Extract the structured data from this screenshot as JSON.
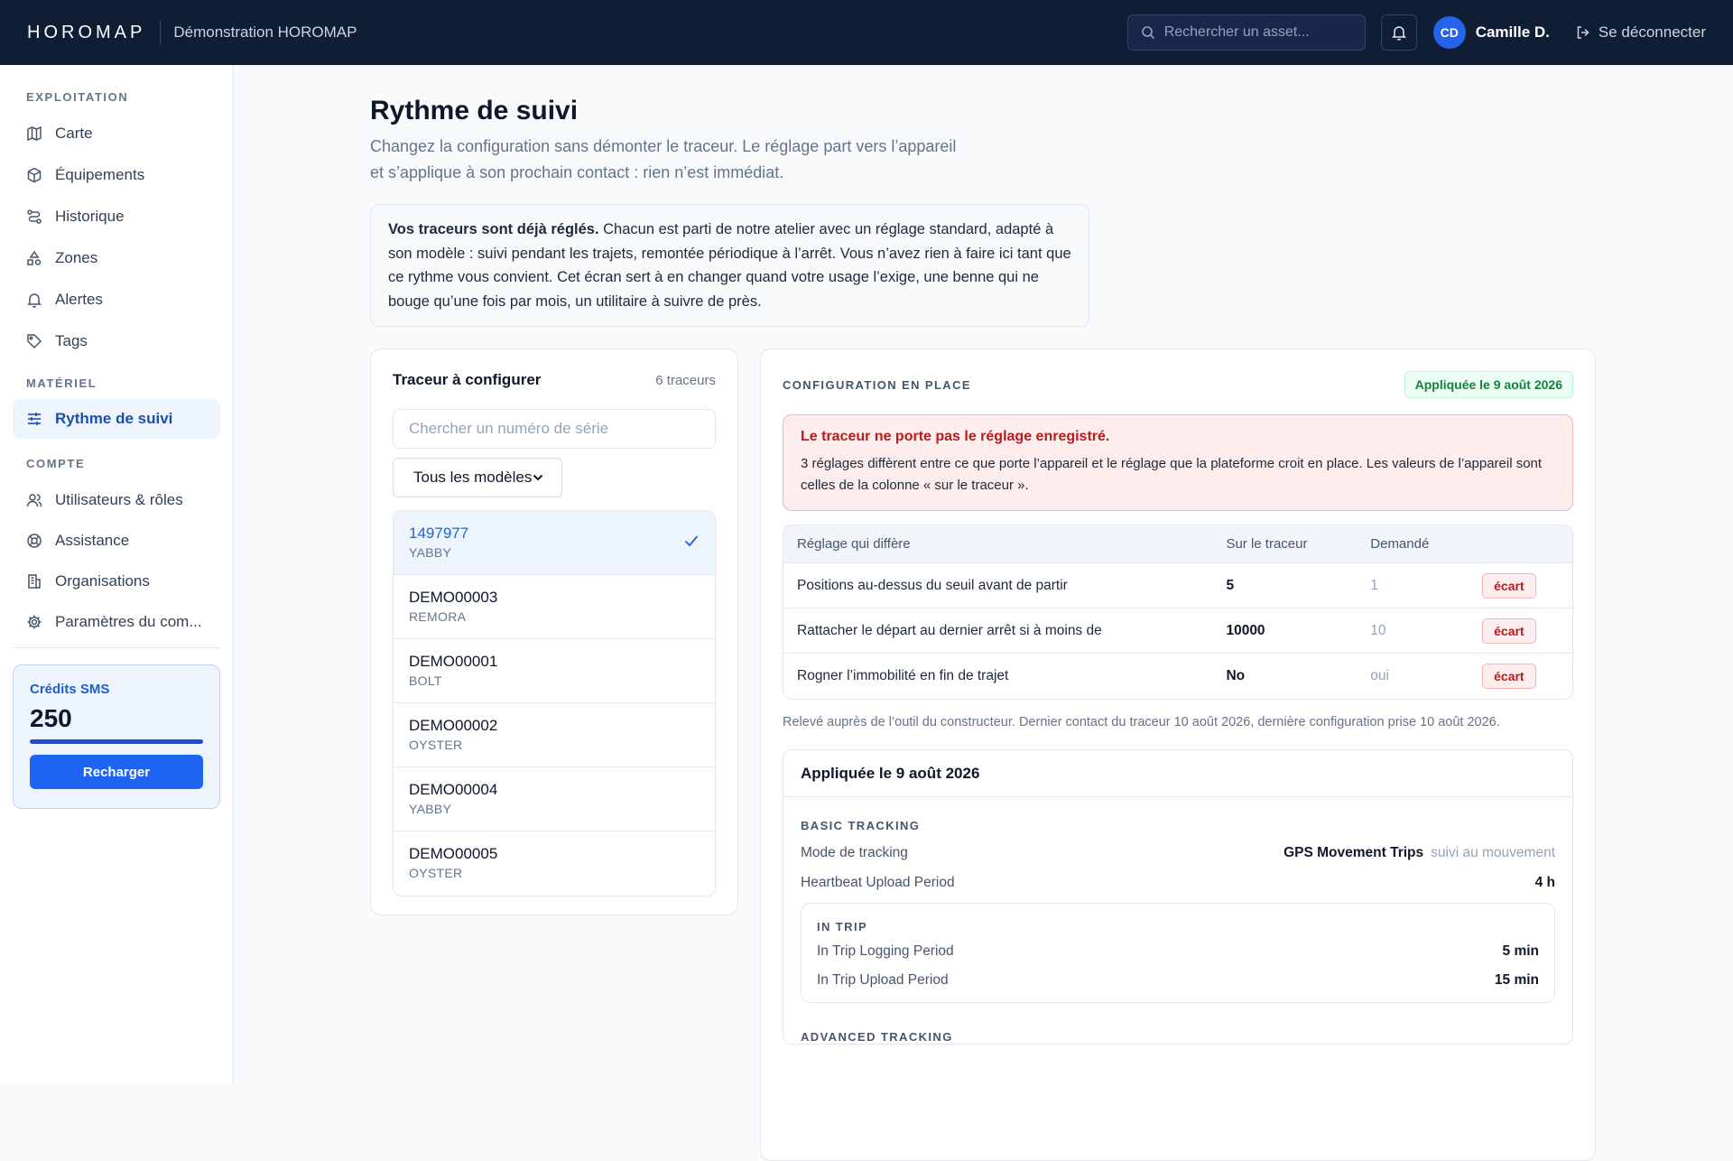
{
  "topbar": {
    "logo": "HOROMAP",
    "org_name": "Démonstration HOROMAP",
    "search_placeholder": "Rechercher un asset...",
    "avatar_initials": "CD",
    "user_name": "Camille D.",
    "logout_label": "Se déconnecter"
  },
  "sidebar": {
    "sections": [
      {
        "title": "EXPLOITATION",
        "items": [
          {
            "label": "Carte",
            "icon": "map-icon"
          },
          {
            "label": "Équipements",
            "icon": "box-icon"
          },
          {
            "label": "Historique",
            "icon": "route-icon"
          },
          {
            "label": "Zones",
            "icon": "shapes-icon"
          },
          {
            "label": "Alertes",
            "icon": "bell-icon"
          },
          {
            "label": "Tags",
            "icon": "tag-icon"
          }
        ]
      },
      {
        "title": "MATÉRIEL",
        "items": [
          {
            "label": "Rythme de suivi",
            "icon": "sliders-icon",
            "active": true
          }
        ]
      },
      {
        "title": "COMPTE",
        "items": [
          {
            "label": "Utilisateurs & rôles",
            "icon": "users-icon"
          },
          {
            "label": "Assistance",
            "icon": "lifebuoy-icon"
          },
          {
            "label": "Organisations",
            "icon": "building-icon"
          },
          {
            "label": "Paramètres du com...",
            "icon": "gear-icon"
          }
        ]
      }
    ],
    "sms": {
      "title": "Crédits SMS",
      "value": "250",
      "level": 1.0,
      "button": "Recharger"
    }
  },
  "page": {
    "title": "Rythme de suivi",
    "subtitle_line1": "Changez la configuration sans démonter le traceur. Le réglage part vers l’appareil",
    "subtitle_line2": "et s’applique à son prochain contact : rien n’est immédiat.",
    "info_bold": "Vos traceurs sont déjà réglés.",
    "info_text": " Chacun est parti de notre atelier avec un réglage standard, adapté à son modèle : suivi pendant les trajets, remontée périodique à l’arrêt. Vous n’avez rien à faire ici tant que ce rythme vous convient. Cet écran sert à en changer quand votre usage l’exige, une benne qui ne bouge qu’une fois par mois, un utilitaire à suivre de près."
  },
  "trackers": {
    "title": "Traceur à configurer",
    "count": "6 traceurs",
    "search_placeholder": "Chercher un numéro de série",
    "model_filter": "Tous les modèles",
    "items": [
      {
        "serial": "1497977",
        "model": "YABBY",
        "selected": true
      },
      {
        "serial": "DEMO00003",
        "model": "REMORA"
      },
      {
        "serial": "DEMO00001",
        "model": "BOLT"
      },
      {
        "serial": "DEMO00002",
        "model": "OYSTER"
      },
      {
        "serial": "DEMO00004",
        "model": "YABBY"
      },
      {
        "serial": "DEMO00005",
        "model": "OYSTER"
      }
    ]
  },
  "config": {
    "label": "CONFIGURATION EN PLACE",
    "badge": "Appliquée le 9 août 2026",
    "alert_title": "Le traceur ne porte pas le réglage enregistré.",
    "alert_body": "3 réglages diffèrent entre ce que porte l’appareil et le réglage que la plateforme croit en place. Les valeurs de l’appareil sont celles de la colonne « sur le traceur ».",
    "diff_headers": [
      "Réglage qui diffère",
      "Sur le traceur",
      "Demandé",
      ""
    ],
    "diff_rows": [
      {
        "setting": "Positions au-dessus du seuil avant de partir",
        "on_tracker": "5",
        "requested": "1",
        "badge": "écart"
      },
      {
        "setting": "Rattacher le départ au dernier arrêt si à moins de",
        "on_tracker": "10000",
        "requested": "10",
        "badge": "écart"
      },
      {
        "setting": "Rogner l’immobilité en fin de trajet",
        "on_tracker": "No",
        "requested": "oui",
        "badge": "écart"
      }
    ],
    "note": "Relevé auprès de l’outil du constructeur. Dernier contact du traceur 10 août 2026, dernière configuration prise 10 août 2026.",
    "applied_title": "Appliquée le 9 août 2026",
    "basic_label": "BASIC TRACKING",
    "mode_label": "Mode de tracking",
    "mode_value": "GPS Movement Trips",
    "mode_hint": "suivi au mouvement",
    "heartbeat_label": "Heartbeat Upload Period",
    "heartbeat_value": "4 h",
    "in_trip_label": "IN TRIP",
    "in_trip_logging_label": "In Trip Logging Period",
    "in_trip_logging_value": "5 min",
    "in_trip_upload_label": "In Trip Upload Period",
    "in_trip_upload_value": "15 min",
    "advanced_label": "ADVANCED TRACKING"
  },
  "colors": {
    "topbar": "#0f1e35",
    "accent": "#1d64f2",
    "error": "#b91c1c",
    "success": "#15803d"
  }
}
